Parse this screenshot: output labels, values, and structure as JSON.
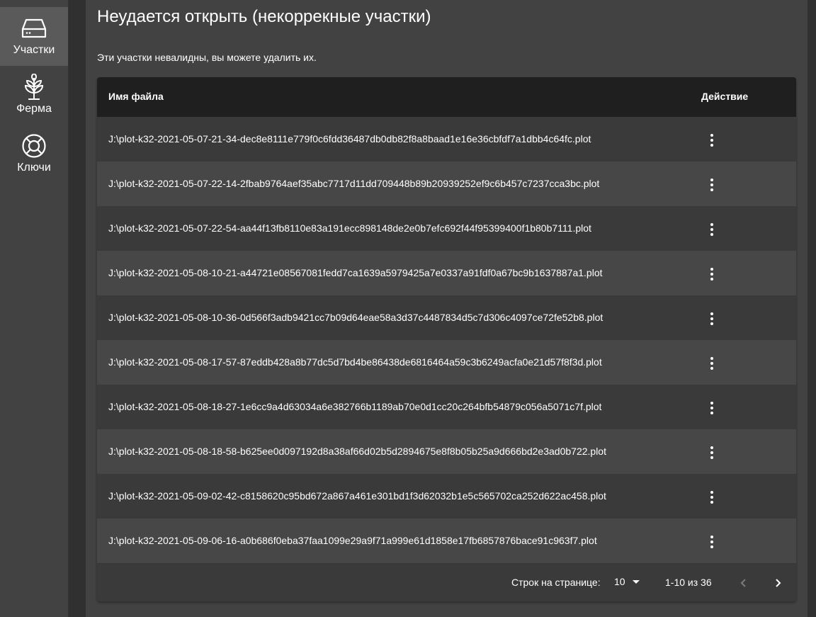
{
  "sidebar": {
    "items": [
      {
        "label": "Участки",
        "icon": "hard-drive-icon",
        "active": true
      },
      {
        "label": "Ферма",
        "icon": "sprout-icon",
        "active": false
      },
      {
        "label": "Ключи",
        "icon": "lifebuoy-icon",
        "active": false
      }
    ]
  },
  "page": {
    "title": "Неудается открыть (некоррекные участки)",
    "subtitle": "Эти участки невалидны, вы можете удалить их."
  },
  "table": {
    "columns": {
      "name": "Имя файла",
      "action": "Действие"
    },
    "rows": [
      "J:\\plot-k32-2021-05-07-21-34-dec8e8111e779f0c6fdd36487db0db82f8a8baad1e16e36cbfdf7a1dbb4c64fc.plot",
      "J:\\plot-k32-2021-05-07-22-14-2fbab9764aef35abc7717d11dd709448b89b20939252ef9c6b457c7237cca3bc.plot",
      "J:\\plot-k32-2021-05-07-22-54-aa44f13fb8110e83a191ecc898148de2e0b7efc692f44f95399400f1b80b7111.plot",
      "J:\\plot-k32-2021-05-08-10-21-a44721e08567081fedd7ca1639a5979425a7e0337a91fdf0a67bc9b1637887a1.plot",
      "J:\\plot-k32-2021-05-08-10-36-0d566f3adb9421cc7b09d64eae58a3d37c4487834d5c7d306c4097ce72fe52b8.plot",
      "J:\\plot-k32-2021-05-08-17-57-87eddb428a8b77dc5d7bd4be86438de6816464a59c3b6249acfa0e21d57f8f3d.plot",
      "J:\\plot-k32-2021-05-08-18-27-1e6cc9a4d63034a6e382766b1189ab70e0d1cc20c264bfb54879c056a5071c7f.plot",
      "J:\\plot-k32-2021-05-08-18-58-b625ee0d097192d8a38af66d02b5d2894675e8f8b05b25a9d666bd2e3ad0b722.plot",
      "J:\\plot-k32-2021-05-09-02-42-c8158620c95bd672a867a461e301bd1f3d62032b1e5c565702ca252d622ac458.plot",
      "J:\\plot-k32-2021-05-09-06-16-a0b686f0eba37faa1099e29a9f71a999e61d1858e17fb6857876bace91c963f7.plot"
    ],
    "row_action_icon": "more-vertical-icon"
  },
  "pagination": {
    "rows_per_page_label": "Строк на странице:",
    "rows_per_page_value": "10",
    "range_text": "1-10 из 36"
  },
  "colors": {
    "background": "#424242",
    "header": "#1f1f1f",
    "row_odd": "#3a3a3a",
    "row_even": "#474747",
    "text": "#ffffff"
  }
}
